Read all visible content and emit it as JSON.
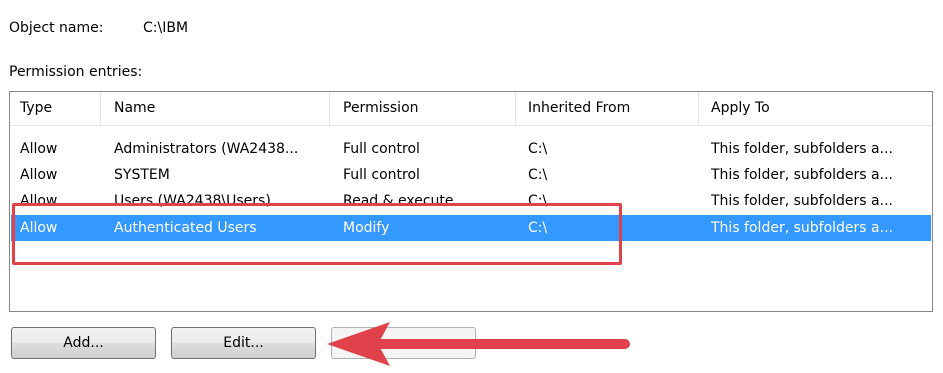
{
  "object": {
    "label": "Object name:",
    "value": "C:\\IBM"
  },
  "entries_label": "Permission entries:",
  "columns": [
    "Type",
    "Name",
    "Permission",
    "Inherited From",
    "Apply To"
  ],
  "rows": [
    {
      "type": "Allow",
      "name": "Administrators (WA2438...",
      "permission": "Full control",
      "inherited_from": "C:\\",
      "apply_to": "This folder, subfolders a..."
    },
    {
      "type": "Allow",
      "name": "SYSTEM",
      "permission": "Full control",
      "inherited_from": "C:\\",
      "apply_to": "This folder, subfolders a..."
    },
    {
      "type": "Allow",
      "name": "Users (WA2438\\Users)",
      "permission": "Read & execute",
      "inherited_from": "C:\\",
      "apply_to": "This folder, subfolders a..."
    },
    {
      "type": "Allow",
      "name": "Authenticated Users",
      "permission": "Modify",
      "inherited_from": "C:\\",
      "apply_to": "This folder, subfolders a...",
      "selected": true
    }
  ],
  "buttons": {
    "add": "Add...",
    "edit": "Edit..."
  },
  "colors": {
    "selection": "#3399ff",
    "annotation": "#e0414a"
  }
}
